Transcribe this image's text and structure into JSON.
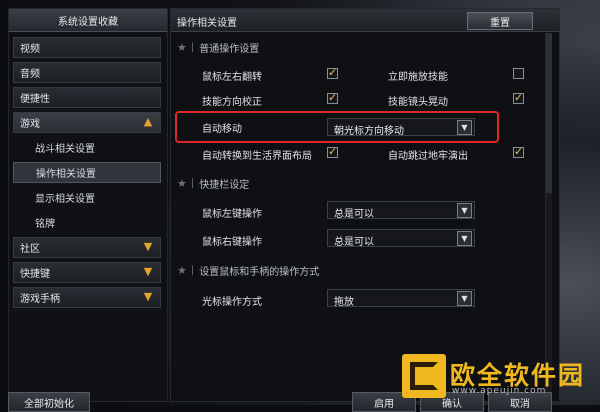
{
  "sidebar": {
    "title": "系统设置收藏",
    "items": [
      {
        "label": "视频"
      },
      {
        "label": "音频"
      },
      {
        "label": "便捷性"
      },
      {
        "label": "游戏",
        "expanded": true
      },
      {
        "label": "战斗相关设置"
      },
      {
        "label": "操作相关设置",
        "active": true
      },
      {
        "label": "显示相关设置"
      },
      {
        "label": "铭牌"
      },
      {
        "label": "社区"
      },
      {
        "label": "快捷键"
      },
      {
        "label": "游戏手柄"
      }
    ],
    "reset_all": "全部初始化"
  },
  "main": {
    "title": "操作相关设置",
    "reset_label": "重置",
    "sections": {
      "general": "普通操作设置",
      "quickbar": "快捷栏设定",
      "mouse_gamepad": "设置鼠标和手柄的操作方式"
    },
    "options": {
      "mouse_swap": {
        "label": "鼠标左右翻转",
        "checked": true
      },
      "instant_skill": {
        "label": "立即施放技能",
        "checked": false
      },
      "skill_dir": {
        "label": "技能方向校正",
        "checked": true
      },
      "skill_shake": {
        "label": "技能镜头晃动",
        "checked": true
      },
      "auto_move": {
        "label": "自动移动",
        "value": "朝光标方向移动"
      },
      "life_layout": {
        "label": "自动转换到生活界面布局",
        "checked": true
      },
      "skip_dungeon": {
        "label": "自动跳过地牢演出",
        "checked": true
      },
      "left_click": {
        "label": "鼠标左键操作",
        "value": "总是可以"
      },
      "right_click": {
        "label": "鼠标右键操作",
        "value": "总是可以"
      },
      "cursor_mode": {
        "label": "光标操作方式",
        "value": "拖放"
      }
    }
  },
  "footer": {
    "apply": "启用",
    "confirm": "确认",
    "cancel": "取消"
  },
  "watermark": {
    "text": "欧全软件园",
    "url": "www.apeujin.com"
  },
  "colors": {
    "highlight": "#e0262b",
    "accent": "#e3a22b",
    "watermark": "#f0b81e"
  }
}
